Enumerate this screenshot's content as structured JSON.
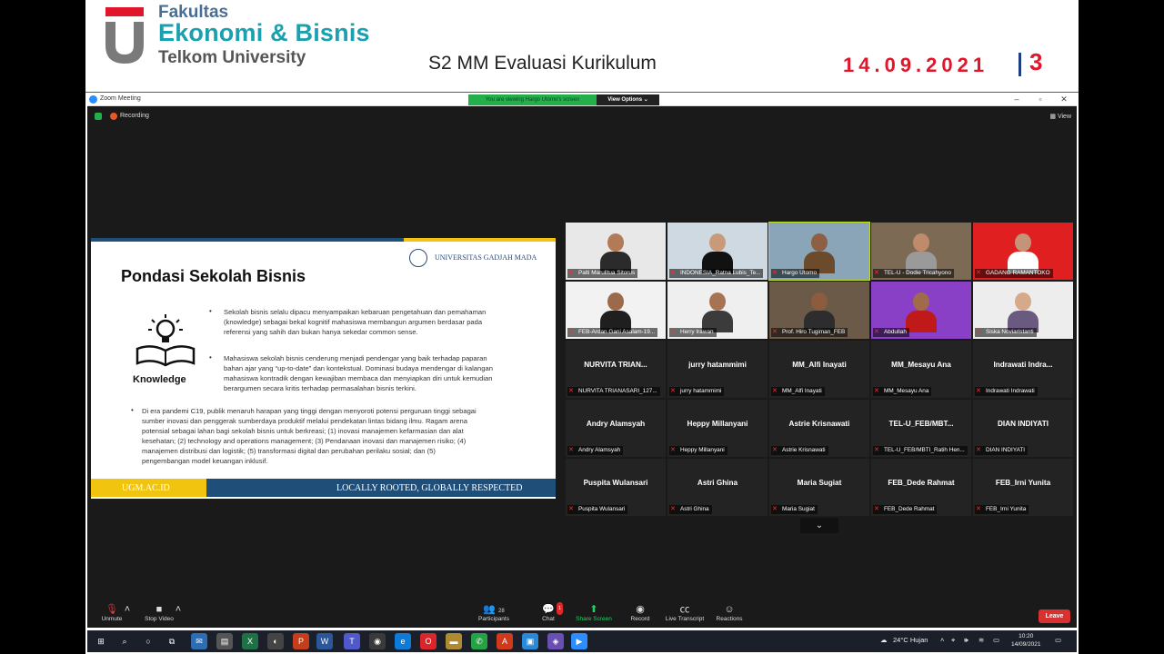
{
  "header": {
    "logo_line1": "Fakultas",
    "logo_line2": "Ekonomi & Bisnis",
    "logo_line3": "Telkom University",
    "title": "S2 MM Evaluasi Kurikulum",
    "date": "14.09.2021",
    "page_number": "3"
  },
  "zoom": {
    "window_title": "Zoom Meeting",
    "viewing_banner": "You are viewing Hargo Utomo's screen",
    "view_options": "View Options ⌄",
    "recording_label": "Recording",
    "view_label": "View"
  },
  "slide": {
    "university": "UNIVERSITAS GADJAH MADA",
    "title": "Pondasi Sekolah Bisnis",
    "knowledge_label": "Knowledge",
    "para1_l1": "Sekolah bisnis selalu dipacu menyampaikan kebaruan pengetahuan dan pemahaman",
    "para1_l2": "(knowledge) sebagai bekal kognitif mahasiswa membangun argumen berdasar pada",
    "para1_l3": "referensi yang sahih dan bukan hanya sekedar common sense.",
    "para2_l1": "Mahasiswa sekolah bisnis cenderung menjadi pendengar yang baik terhadap paparan",
    "para2_l2": "bahan ajar yang “up-to-date” dan kontekstual.  Dominasi budaya mendengar di kalangan",
    "para2_l3": "mahasiswa kontradik dengan kewajiban membaca dan menyiapkan diri untuk kemudian",
    "para2_l4": "berargumen secara kritis terhadap permasalahan bisnis terkini.",
    "para3_l1": "Di era pandemi C19, publik menaruh harapan yang tinggi dengan menyoroti potensi perguruan tinggi sebagai",
    "para3_l2": "sumber inovasi dan penggerak sumberdaya produktif melalui pendekatan lintas bidang ilmu. Ragam arena",
    "para3_l3": "potensial sebagai lahan bagi sekolah bisnis untuk berkreasi; (1) inovasi manajemen kefarmasian dan alat",
    "para3_l4": "kesehatan; (2) technology and operations management; (3) Pendanaan inovasi dan manajemen risiko; (4)",
    "para3_l5": "manajemen distribusi dan logistik; (5) transformasi digital dan perubahan perilaku sosial; dan (5)",
    "para3_l6": "pengembangan model keuangan inklusif.",
    "footer_url": "UGM.AC.ID",
    "footer_tagline": "LOCALLY ROOTED, GLOBALLY RESPECTED"
  },
  "participants_video": [
    {
      "name": "Palti Marulitua Sitorus",
      "bg": "#e8e8e8",
      "skin": "#b27a56",
      "shirt": "#2b2b2b"
    },
    {
      "name": "INDONESIA_Ratna Lubis_Te...",
      "bg": "#cfd9e2",
      "skin": "#c99a7a",
      "shirt": "#111111"
    },
    {
      "name": "Hargo Utomo",
      "bg": "#8aa4b8",
      "skin": "#8e5f43",
      "shirt": "#6b4b2b"
    },
    {
      "name": "TEL-U - Dodie Tricahyono",
      "bg": "#7d6a55",
      "skin": "#c08b6a",
      "shirt": "#9a9a9a"
    },
    {
      "name": "GADANG RAMANTOKO",
      "bg": "#e02020",
      "skin": "#c59478",
      "shirt": "#ffffff"
    },
    {
      "name": "FEB-Ardan Gani Asalam-19...",
      "bg": "#f2f2f2",
      "skin": "#9b6a4a",
      "shirt": "#1f1f1f"
    },
    {
      "name": "Herry Irawan",
      "bg": "#efefef",
      "skin": "#a87353",
      "shirt": "#3b3b3b"
    },
    {
      "name": "Prof. Hiro Tugiman_FEB",
      "bg": "#6b5a48",
      "skin": "#8c5c3f",
      "shirt": "#2d2d2d"
    },
    {
      "name": "Abdullah",
      "bg": "#8a3fc7",
      "skin": "#a06b4b",
      "shirt": "#c01919"
    },
    {
      "name": "Siska Noviaristanti",
      "bg": "#ededed",
      "skin": "#d6a98b",
      "shirt": "#6b5a80"
    }
  ],
  "participants_names": [
    {
      "big": "NURVITA TRIAN...",
      "name": "NURVITA TRIANASARI_127..."
    },
    {
      "big": "jurry hatammimi",
      "name": "jurry hatammimi"
    },
    {
      "big": "MM_Alfi Inayati",
      "name": "MM_Alfi Inayati"
    },
    {
      "big": "MM_Mesayu Ana",
      "name": "MM_Mesayu Ana"
    },
    {
      "big": "Indrawati  Indra...",
      "name": "Indrawati Indrawati"
    },
    {
      "big": "Andry Alamsyah",
      "name": "Andry Alamsyah"
    },
    {
      "big": "Heppy Millanyani",
      "name": "Heppy Millanyani"
    },
    {
      "big": "Astrie Krisnawati",
      "name": "Astrie Krisnawati"
    },
    {
      "big": "TEL-U_FEB/MBT...",
      "name": "TEL-U_FEB/MBTI_Ratih Hen..."
    },
    {
      "big": "DIAN INDIYATI",
      "name": "DIAN INDIYATI"
    },
    {
      "big": "Puspita Wulansari",
      "name": "Puspita Wulansari"
    },
    {
      "big": "Astri Ghina",
      "name": "Astri Ghina"
    },
    {
      "big": "Maria Sugiat",
      "name": "Maria Sugiat"
    },
    {
      "big": "FEB_Dede Rahmat",
      "name": "FEB_Dede Rahmat"
    },
    {
      "big": "FEB_Irni Yunita",
      "name": "FEB_Irni Yunita"
    }
  ],
  "toolbar": {
    "unmute": "Unmute",
    "stop_video": "Stop Video",
    "participants": "Participants",
    "participants_count": "28",
    "chat": "Chat",
    "chat_badge": "1",
    "share_screen": "Share Screen",
    "record": "Record",
    "live_transcript": "Live Transcript",
    "reactions": "Reactions",
    "leave": "Leave"
  },
  "taskbar": {
    "weather": "24°C  Hujan",
    "time": "10:20",
    "date": "14/09/2021"
  },
  "colors": {
    "accent_red": "#e0162b",
    "teal": "#1aa0ae",
    "ugm_blue": "#1f4e79",
    "ugm_yellow": "#f1c40f",
    "active_speaker": "#c4e11f"
  }
}
